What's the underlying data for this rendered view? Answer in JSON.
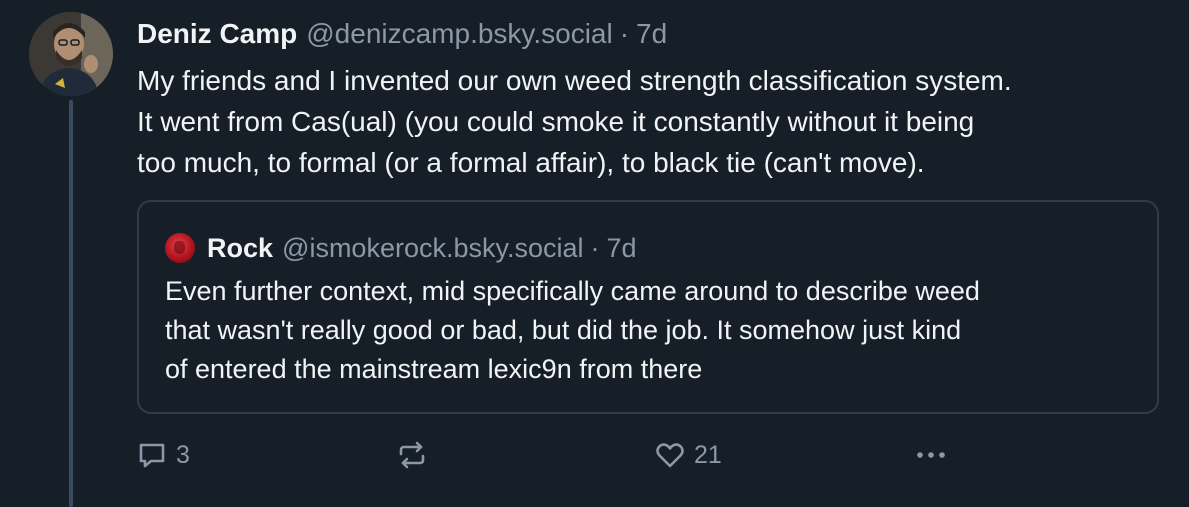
{
  "post": {
    "author_name": "Deniz Camp",
    "author_handle": "@denizcamp.bsky.social",
    "separator": "·",
    "timestamp": "7d",
    "text": "My friends and I invented our own weed strength classification system.\nIt went from Cas(ual) (you could smoke it constantly without it being\ntoo much, to formal (or a formal affair), to black tie (can't move)."
  },
  "quote": {
    "author_name": "Rock",
    "author_handle": "@ismokerock.bsky.social",
    "separator": "·",
    "timestamp": "7d",
    "text": "Even further context, mid specifically came around to describe weed\nthat wasn't really good or bad, but did the job. It somehow just kind\nof entered the mainstream lexic9n from there"
  },
  "actions": {
    "reply_count": "3",
    "repost_count": "",
    "like_count": "21"
  },
  "icons": {
    "reply": "reply-icon",
    "repost": "repost-icon",
    "like": "heart-icon",
    "more": "more-options-icon"
  },
  "colors": {
    "background": "#161e27",
    "text": "#f1f3f5",
    "muted": "#8b98a8",
    "border": "#2f3c4b",
    "thread_line": "#3b4b5e"
  }
}
